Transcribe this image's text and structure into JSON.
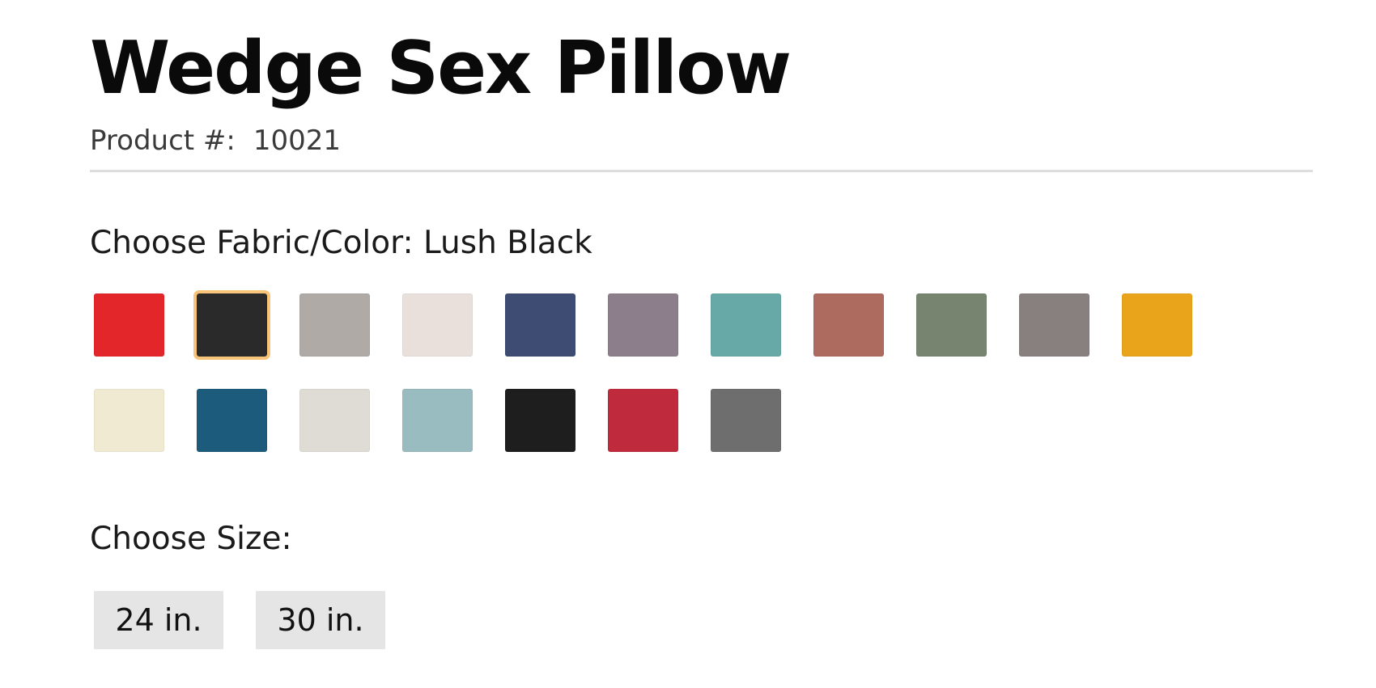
{
  "product": {
    "title": "Wedge Sex Pillow",
    "number_label": "Product #:",
    "number_value": "10021"
  },
  "fabric": {
    "label": "Choose Fabric/Color: Lush Black",
    "selected_index": 1,
    "swatches": [
      {
        "name": "red-swatch",
        "color": "#e3262a"
      },
      {
        "name": "lush-black-swatch",
        "color": "#2b2a2a"
      },
      {
        "name": "gray-swatch",
        "color": "#b0aaa6"
      },
      {
        "name": "ivory-swatch",
        "color": "#e9e0dc"
      },
      {
        "name": "navy-swatch",
        "color": "#3e4c73"
      },
      {
        "name": "mauve-swatch",
        "color": "#8c7e8a"
      },
      {
        "name": "teal-swatch",
        "color": "#66a9a7"
      },
      {
        "name": "terracotta-swatch",
        "color": "#ad6a5f"
      },
      {
        "name": "sage-swatch",
        "color": "#768470"
      },
      {
        "name": "taupe-swatch",
        "color": "#88807e"
      },
      {
        "name": "gold-swatch",
        "color": "#e9a41c"
      },
      {
        "name": "cream-swatch",
        "color": "#f1ead2"
      },
      {
        "name": "peacock-swatch",
        "color": "#1c5b7c"
      },
      {
        "name": "pearl-swatch",
        "color": "#dedcd5"
      },
      {
        "name": "seafoam-swatch",
        "color": "#99bcc0"
      },
      {
        "name": "black-swatch",
        "color": "#1e1e1e"
      },
      {
        "name": "crimson-swatch",
        "color": "#bf2a3c"
      },
      {
        "name": "charcoal-swatch",
        "color": "#6e6e6e"
      }
    ]
  },
  "size": {
    "label": "Choose Size:",
    "options": [
      "24 in.",
      "30 in."
    ]
  }
}
